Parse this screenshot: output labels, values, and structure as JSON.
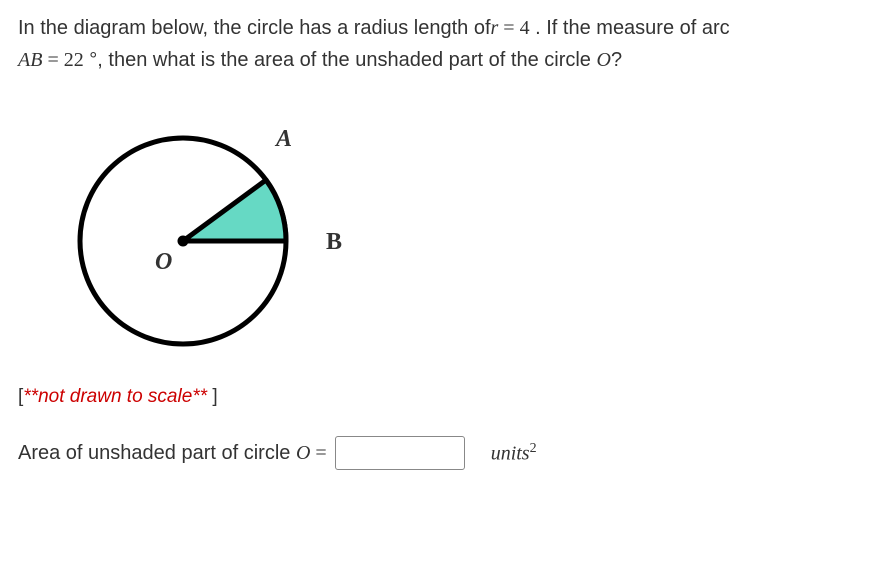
{
  "problem": {
    "line1_pre": "In the diagram below, the circle has a radius length of",
    "r_var": "r",
    "eq1": " = ",
    "r_val": "4",
    "line1_post": " . If the measure of arc",
    "ab_var": "AB",
    "eq2": " = ",
    "arc_deg": "22",
    "deg_sym": " °",
    "line2_mid": ", then what is the area of the unshaded part of the circle ",
    "o_var": "O",
    "qmark": "?"
  },
  "diagram": {
    "label_A": "A",
    "label_B": "B",
    "label_O": "O"
  },
  "note": {
    "open": "[",
    "text": "**not drawn to scale** ",
    "close": "]"
  },
  "answer": {
    "label_pre": "Area of unshaded part of circle ",
    "o_var": "O",
    "eq": " = ",
    "value": "",
    "units_word": "units",
    "units_exp": "2"
  }
}
